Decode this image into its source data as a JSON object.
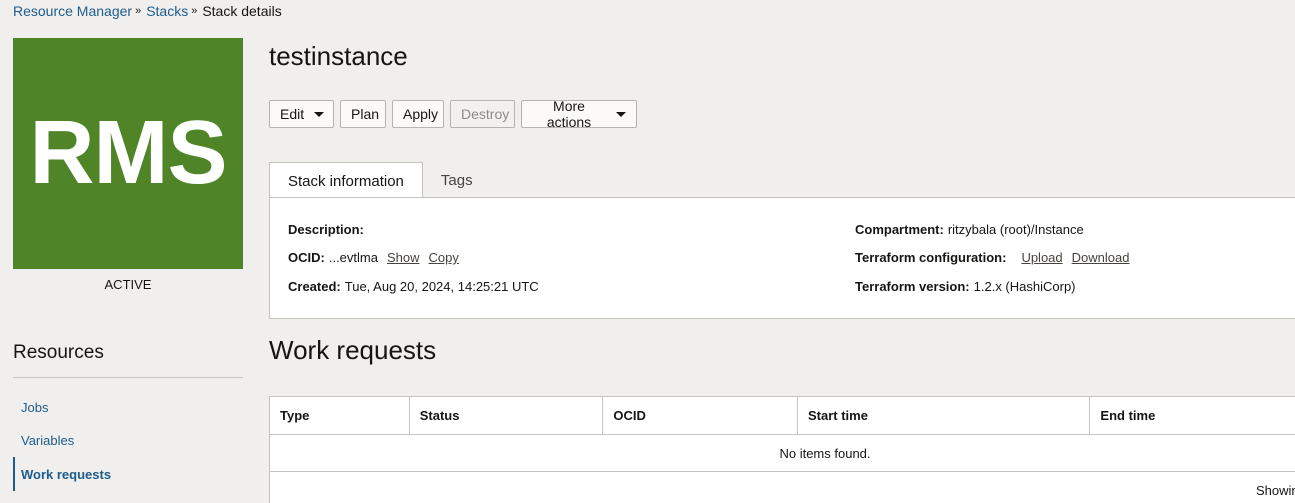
{
  "breadcrumb": {
    "items": [
      "Resource Manager",
      "Stacks"
    ],
    "current": "Stack details",
    "separator": "»"
  },
  "logo": {
    "text": "RMS",
    "color": "#4f8527"
  },
  "status": "ACTIVE",
  "title": "testinstance",
  "actions": {
    "edit": "Edit",
    "plan": "Plan",
    "apply": "Apply",
    "destroy": "Destroy",
    "more": "More actions"
  },
  "tabs": [
    "Stack information",
    "Tags"
  ],
  "stack_info": {
    "description_label": "Description:",
    "description_value": "",
    "ocid_label": "OCID:",
    "ocid_value": "...evtlma",
    "show": "Show",
    "copy": "Copy",
    "created_label": "Created:",
    "created_value": "Tue, Aug 20, 2024, 14:25:21 UTC",
    "compartment_label": "Compartment:",
    "compartment_value": "ritzybala (root)/Instance",
    "tf_config_label": "Terraform configuration:",
    "upload": "Upload",
    "download": "Download",
    "tf_version_label": "Terraform version:",
    "tf_version_value": "1.2.x (HashiCorp)"
  },
  "resources": {
    "title": "Resources",
    "items": [
      "Jobs",
      "Variables",
      "Work requests"
    ]
  },
  "work_requests": {
    "title": "Work requests",
    "columns": [
      "Type",
      "Status",
      "OCID",
      "Start time",
      "End time"
    ],
    "empty": "No items found.",
    "footer": "Showin"
  }
}
